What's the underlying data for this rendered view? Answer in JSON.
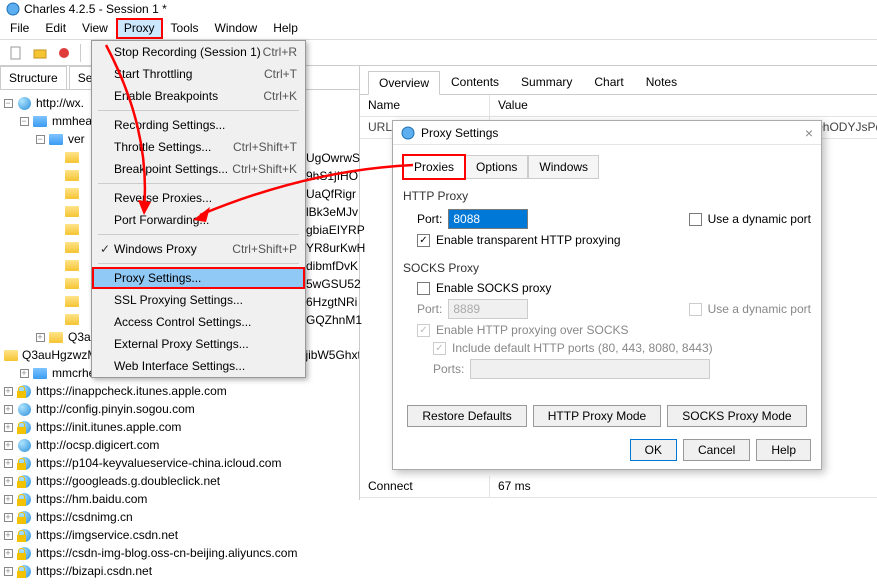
{
  "window": {
    "title": "Charles 4.2.5 - Session 1 *"
  },
  "menu": [
    "File",
    "Edit",
    "View",
    "Proxy",
    "Tools",
    "Window",
    "Help"
  ],
  "menu_open_index": 3,
  "dropdown": {
    "items": [
      {
        "label": "Stop Recording (Session 1)",
        "shortcut": "Ctrl+R"
      },
      {
        "label": "Start Throttling",
        "shortcut": "Ctrl+T"
      },
      {
        "label": "Enable Breakpoints",
        "shortcut": "Ctrl+K"
      },
      {
        "sep": true
      },
      {
        "label": "Recording Settings..."
      },
      {
        "label": "Throttle Settings...",
        "shortcut": "Ctrl+Shift+T"
      },
      {
        "label": "Breakpoint Settings...",
        "shortcut": "Ctrl+Shift+K"
      },
      {
        "sep": true
      },
      {
        "label": "Reverse Proxies..."
      },
      {
        "label": "Port Forwarding..."
      },
      {
        "sep": true
      },
      {
        "label": "Windows Proxy",
        "shortcut": "Ctrl+Shift+P",
        "checked": true
      },
      {
        "sep": true
      },
      {
        "label": "Proxy Settings...",
        "highlight": true,
        "boxed": true
      },
      {
        "label": "SSL Proxying Settings..."
      },
      {
        "label": "Access Control Settings..."
      },
      {
        "label": "External Proxy Settings..."
      },
      {
        "label": "Web Interface Settings..."
      }
    ]
  },
  "left_tabs": [
    "Structure",
    "Sequ"
  ],
  "tree": [
    {
      "indent": 0,
      "exp": "-",
      "icon": "globe",
      "label": "http://wx."
    },
    {
      "indent": 1,
      "exp": "-",
      "icon": "folder-blue",
      "label": "mmhea"
    },
    {
      "indent": 2,
      "exp": "-",
      "icon": "folder-blue",
      "label": "ver"
    },
    {
      "indent": 3,
      "exp": "",
      "icon": "folder-yellow",
      "label": "",
      "code": "UgOwrwS"
    },
    {
      "indent": 3,
      "exp": "",
      "icon": "folder-yellow",
      "label": "",
      "code": "9hS1jIHO"
    },
    {
      "indent": 3,
      "exp": "",
      "icon": "folder-yellow",
      "label": "",
      "code": "UaQfRigr"
    },
    {
      "indent": 3,
      "exp": "",
      "icon": "folder-yellow",
      "label": "",
      "code": "lBk3eMJv"
    },
    {
      "indent": 3,
      "exp": "",
      "icon": "folder-yellow",
      "label": "",
      "code": "gbiaEIYRP"
    },
    {
      "indent": 3,
      "exp": "",
      "icon": "folder-yellow",
      "label": "",
      "code": "YR8urKwH"
    },
    {
      "indent": 3,
      "exp": "",
      "icon": "folder-yellow",
      "label": "",
      "code": "dibmfDvK"
    },
    {
      "indent": 3,
      "exp": "",
      "icon": "folder-yellow",
      "label": "",
      "code": "5wGSU52"
    },
    {
      "indent": 3,
      "exp": "",
      "icon": "folder-yellow",
      "label": "",
      "code": "6HzgtNRi"
    },
    {
      "indent": 3,
      "exp": "",
      "icon": "folder-yellow",
      "label": "",
      "code": "GQZhnM1"
    },
    {
      "indent": 2,
      "exp": "+",
      "icon": "folder-yellow",
      "label": "Q3auGnzdrwZ2q3RHaghMwz7HeDYlicr"
    },
    {
      "indent": 2,
      "exp": "",
      "icon": "folder-yellow",
      "label": "Q3auHgzwzM7GE8h7ZGm12bW6MeicL8lt1ia8CESZjibW5Ghxt"
    },
    {
      "indent": 1,
      "exp": "+",
      "icon": "folder-blue",
      "label": "mmcrhead"
    },
    {
      "indent": 0,
      "exp": "+",
      "icon": "globe-lock",
      "label": "https://inappcheck.itunes.apple.com"
    },
    {
      "indent": 0,
      "exp": "+",
      "icon": "globe",
      "label": "http://config.pinyin.sogou.com"
    },
    {
      "indent": 0,
      "exp": "+",
      "icon": "globe-lock",
      "label": "https://init.itunes.apple.com"
    },
    {
      "indent": 0,
      "exp": "+",
      "icon": "globe",
      "label": "http://ocsp.digicert.com"
    },
    {
      "indent": 0,
      "exp": "+",
      "icon": "globe-lock",
      "label": "https://p104-keyvalueservice-china.icloud.com"
    },
    {
      "indent": 0,
      "exp": "+",
      "icon": "globe-lock",
      "label": "https://googleads.g.doubleclick.net"
    },
    {
      "indent": 0,
      "exp": "+",
      "icon": "globe-lock",
      "label": "https://hm.baidu.com"
    },
    {
      "indent": 0,
      "exp": "+",
      "icon": "globe-lock",
      "label": "https://csdnimg.cn"
    },
    {
      "indent": 0,
      "exp": "+",
      "icon": "globe-lock",
      "label": "https://imgservice.csdn.net"
    },
    {
      "indent": 0,
      "exp": "+",
      "icon": "globe-lock",
      "label": "https://csdn-img-blog.oss-cn-beijing.aliyuncs.com"
    },
    {
      "indent": 0,
      "exp": "+",
      "icon": "globe-lock",
      "label": "https://bizapi.csdn.net"
    }
  ],
  "right_tabs": [
    "Overview",
    "Contents",
    "Summary",
    "Chart",
    "Notes"
  ],
  "right_active_tab": 0,
  "nv": {
    "headers": [
      "Name",
      "Value"
    ],
    "rows": [
      [
        "URL",
        "http://wx.qlogo.cn/mmhead/ver_1/NWJH4IkcFwiKw6djrcporOhODYJsPqu3Lwxxl6"
      ],
      [
        "Connect",
        "67 ms"
      ]
    ]
  },
  "dialog": {
    "title": "Proxy Settings",
    "tabs": [
      "Proxies",
      "Options",
      "Windows"
    ],
    "active_tab": 0,
    "http": {
      "title": "HTTP Proxy",
      "port_label": "Port:",
      "port": "8088",
      "dyn_label": "Use a dynamic port",
      "transparent": "Enable transparent HTTP proxying"
    },
    "socks": {
      "title": "SOCKS Proxy",
      "enable": "Enable SOCKS proxy",
      "port_label": "Port:",
      "port": "8889",
      "dyn_label": "Use a dynamic port",
      "http_over": "Enable HTTP proxying over SOCKS",
      "include": "Include default HTTP ports (80, 443, 8080, 8443)",
      "ports_label": "Ports:"
    },
    "btns1": [
      "Restore Defaults",
      "HTTP Proxy Mode",
      "SOCKS Proxy Mode"
    ],
    "btns2": [
      "OK",
      "Cancel",
      "Help"
    ]
  }
}
